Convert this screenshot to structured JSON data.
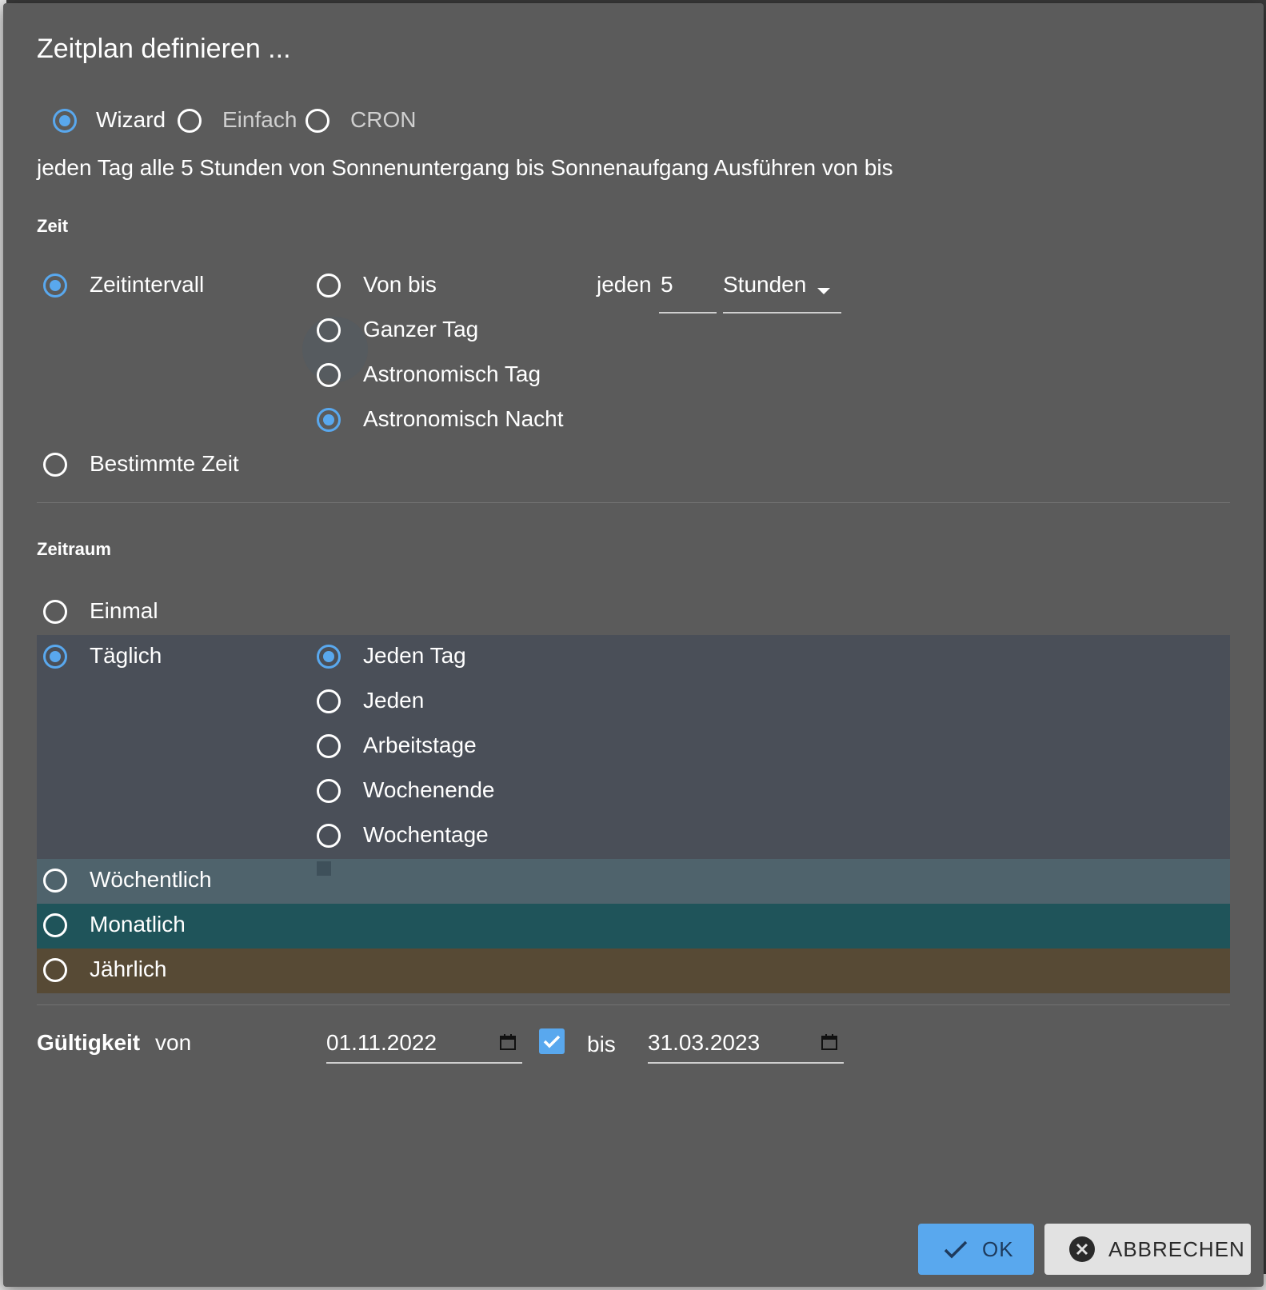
{
  "dialog": {
    "title": "Zeitplan definieren ...",
    "mode": {
      "options": [
        "Wizard",
        "Einfach",
        "CRON"
      ],
      "selected": "Wizard"
    },
    "summary": "jeden Tag alle 5 Stunden von Sonnenuntergang bis Sonnenaufgang Ausführen von bis"
  },
  "zeit": {
    "heading": "Zeit",
    "type_options": [
      "Zeitintervall",
      "Bestimmte Zeit"
    ],
    "type_selected": "Zeitintervall",
    "range_options": [
      "Von bis",
      "Ganzer Tag",
      "Astronomisch Tag",
      "Astronomisch Nacht"
    ],
    "range_selected": "Astronomisch Nacht",
    "every_label": "jeden",
    "every_value": "5",
    "unit_value": "Stunden"
  },
  "zeitraum": {
    "heading": "Zeitraum",
    "period_options": [
      "Einmal",
      "Täglich",
      "Wöchentlich",
      "Monatlich",
      "Jährlich"
    ],
    "period_selected": "Täglich",
    "daily_options": [
      "Jeden Tag",
      "Jeden",
      "Arbeitstage",
      "Wochenende",
      "Wochentage"
    ],
    "daily_selected": "Jeden Tag",
    "colors": {
      "taeglich_band": "#4a4f58",
      "woechentlich_band": "#4f636c",
      "monatlich_band": "#1f545a",
      "jaehrlich_band": "#574a35"
    }
  },
  "validity": {
    "label": "Gültigkeit",
    "from_label": "von",
    "from_value": "01.11.2022",
    "to_enabled": true,
    "to_label": "bis",
    "to_value": "31.03.2023"
  },
  "actions": {
    "ok_label": "OK",
    "cancel_label": "ABBRECHEN"
  },
  "colors": {
    "dialog_bg": "#5b5b5b",
    "accent": "#59a8ee"
  }
}
